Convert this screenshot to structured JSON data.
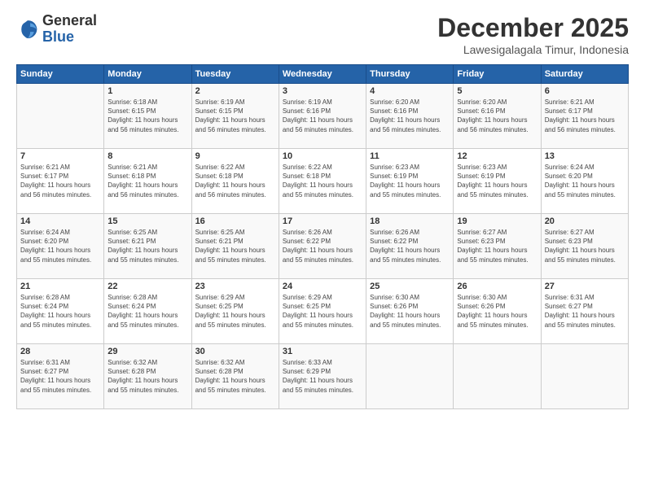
{
  "header": {
    "logo_general": "General",
    "logo_blue": "Blue",
    "month_title": "December 2025",
    "subtitle": "Lawesigalagala Timur, Indonesia"
  },
  "weekdays": [
    "Sunday",
    "Monday",
    "Tuesday",
    "Wednesday",
    "Thursday",
    "Friday",
    "Saturday"
  ],
  "weeks": [
    [
      {
        "day": "",
        "sunrise": "",
        "sunset": "",
        "daylight": ""
      },
      {
        "day": "1",
        "sunrise": "Sunrise: 6:18 AM",
        "sunset": "Sunset: 6:15 PM",
        "daylight": "Daylight: 11 hours and 56 minutes."
      },
      {
        "day": "2",
        "sunrise": "Sunrise: 6:19 AM",
        "sunset": "Sunset: 6:15 PM",
        "daylight": "Daylight: 11 hours and 56 minutes."
      },
      {
        "day": "3",
        "sunrise": "Sunrise: 6:19 AM",
        "sunset": "Sunset: 6:16 PM",
        "daylight": "Daylight: 11 hours and 56 minutes."
      },
      {
        "day": "4",
        "sunrise": "Sunrise: 6:20 AM",
        "sunset": "Sunset: 6:16 PM",
        "daylight": "Daylight: 11 hours and 56 minutes."
      },
      {
        "day": "5",
        "sunrise": "Sunrise: 6:20 AM",
        "sunset": "Sunset: 6:16 PM",
        "daylight": "Daylight: 11 hours and 56 minutes."
      },
      {
        "day": "6",
        "sunrise": "Sunrise: 6:21 AM",
        "sunset": "Sunset: 6:17 PM",
        "daylight": "Daylight: 11 hours and 56 minutes."
      }
    ],
    [
      {
        "day": "7",
        "sunrise": "Sunrise: 6:21 AM",
        "sunset": "Sunset: 6:17 PM",
        "daylight": "Daylight: 11 hours and 56 minutes."
      },
      {
        "day": "8",
        "sunrise": "Sunrise: 6:21 AM",
        "sunset": "Sunset: 6:18 PM",
        "daylight": "Daylight: 11 hours and 56 minutes."
      },
      {
        "day": "9",
        "sunrise": "Sunrise: 6:22 AM",
        "sunset": "Sunset: 6:18 PM",
        "daylight": "Daylight: 11 hours and 56 minutes."
      },
      {
        "day": "10",
        "sunrise": "Sunrise: 6:22 AM",
        "sunset": "Sunset: 6:18 PM",
        "daylight": "Daylight: 11 hours and 55 minutes."
      },
      {
        "day": "11",
        "sunrise": "Sunrise: 6:23 AM",
        "sunset": "Sunset: 6:19 PM",
        "daylight": "Daylight: 11 hours and 55 minutes."
      },
      {
        "day": "12",
        "sunrise": "Sunrise: 6:23 AM",
        "sunset": "Sunset: 6:19 PM",
        "daylight": "Daylight: 11 hours and 55 minutes."
      },
      {
        "day": "13",
        "sunrise": "Sunrise: 6:24 AM",
        "sunset": "Sunset: 6:20 PM",
        "daylight": "Daylight: 11 hours and 55 minutes."
      }
    ],
    [
      {
        "day": "14",
        "sunrise": "Sunrise: 6:24 AM",
        "sunset": "Sunset: 6:20 PM",
        "daylight": "Daylight: 11 hours and 55 minutes."
      },
      {
        "day": "15",
        "sunrise": "Sunrise: 6:25 AM",
        "sunset": "Sunset: 6:21 PM",
        "daylight": "Daylight: 11 hours and 55 minutes."
      },
      {
        "day": "16",
        "sunrise": "Sunrise: 6:25 AM",
        "sunset": "Sunset: 6:21 PM",
        "daylight": "Daylight: 11 hours and 55 minutes."
      },
      {
        "day": "17",
        "sunrise": "Sunrise: 6:26 AM",
        "sunset": "Sunset: 6:22 PM",
        "daylight": "Daylight: 11 hours and 55 minutes."
      },
      {
        "day": "18",
        "sunrise": "Sunrise: 6:26 AM",
        "sunset": "Sunset: 6:22 PM",
        "daylight": "Daylight: 11 hours and 55 minutes."
      },
      {
        "day": "19",
        "sunrise": "Sunrise: 6:27 AM",
        "sunset": "Sunset: 6:23 PM",
        "daylight": "Daylight: 11 hours and 55 minutes."
      },
      {
        "day": "20",
        "sunrise": "Sunrise: 6:27 AM",
        "sunset": "Sunset: 6:23 PM",
        "daylight": "Daylight: 11 hours and 55 minutes."
      }
    ],
    [
      {
        "day": "21",
        "sunrise": "Sunrise: 6:28 AM",
        "sunset": "Sunset: 6:24 PM",
        "daylight": "Daylight: 11 hours and 55 minutes."
      },
      {
        "day": "22",
        "sunrise": "Sunrise: 6:28 AM",
        "sunset": "Sunset: 6:24 PM",
        "daylight": "Daylight: 11 hours and 55 minutes."
      },
      {
        "day": "23",
        "sunrise": "Sunrise: 6:29 AM",
        "sunset": "Sunset: 6:25 PM",
        "daylight": "Daylight: 11 hours and 55 minutes."
      },
      {
        "day": "24",
        "sunrise": "Sunrise: 6:29 AM",
        "sunset": "Sunset: 6:25 PM",
        "daylight": "Daylight: 11 hours and 55 minutes."
      },
      {
        "day": "25",
        "sunrise": "Sunrise: 6:30 AM",
        "sunset": "Sunset: 6:26 PM",
        "daylight": "Daylight: 11 hours and 55 minutes."
      },
      {
        "day": "26",
        "sunrise": "Sunrise: 6:30 AM",
        "sunset": "Sunset: 6:26 PM",
        "daylight": "Daylight: 11 hours and 55 minutes."
      },
      {
        "day": "27",
        "sunrise": "Sunrise: 6:31 AM",
        "sunset": "Sunset: 6:27 PM",
        "daylight": "Daylight: 11 hours and 55 minutes."
      }
    ],
    [
      {
        "day": "28",
        "sunrise": "Sunrise: 6:31 AM",
        "sunset": "Sunset: 6:27 PM",
        "daylight": "Daylight: 11 hours and 55 minutes."
      },
      {
        "day": "29",
        "sunrise": "Sunrise: 6:32 AM",
        "sunset": "Sunset: 6:28 PM",
        "daylight": "Daylight: 11 hours and 55 minutes."
      },
      {
        "day": "30",
        "sunrise": "Sunrise: 6:32 AM",
        "sunset": "Sunset: 6:28 PM",
        "daylight": "Daylight: 11 hours and 55 minutes."
      },
      {
        "day": "31",
        "sunrise": "Sunrise: 6:33 AM",
        "sunset": "Sunset: 6:29 PM",
        "daylight": "Daylight: 11 hours and 55 minutes."
      },
      {
        "day": "",
        "sunrise": "",
        "sunset": "",
        "daylight": ""
      },
      {
        "day": "",
        "sunrise": "",
        "sunset": "",
        "daylight": ""
      },
      {
        "day": "",
        "sunrise": "",
        "sunset": "",
        "daylight": ""
      }
    ]
  ]
}
